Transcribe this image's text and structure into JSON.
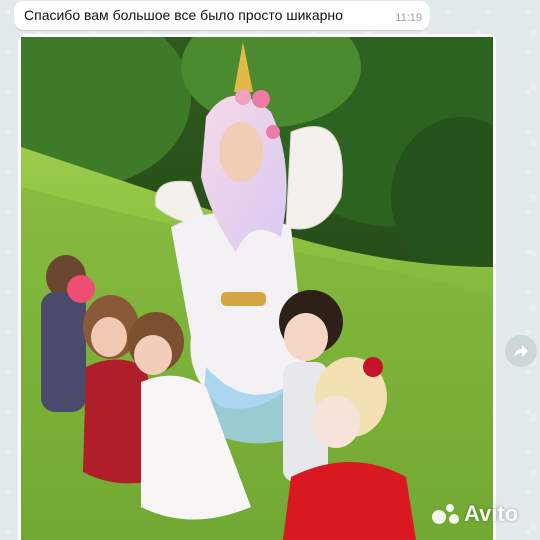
{
  "message": {
    "text": "Спасибо вам большое все было просто шикарно",
    "time": "11:19"
  },
  "attachment": {
    "icon": "photo-icon"
  },
  "actions": {
    "forward_icon": "forward-arrow-icon"
  },
  "watermark": {
    "brand": "Avito",
    "icon": "avito-dots-logo"
  },
  "colors": {
    "chat_background": "#e3eaee",
    "bubble": "#ffffff",
    "time": "#9aa3a8"
  }
}
